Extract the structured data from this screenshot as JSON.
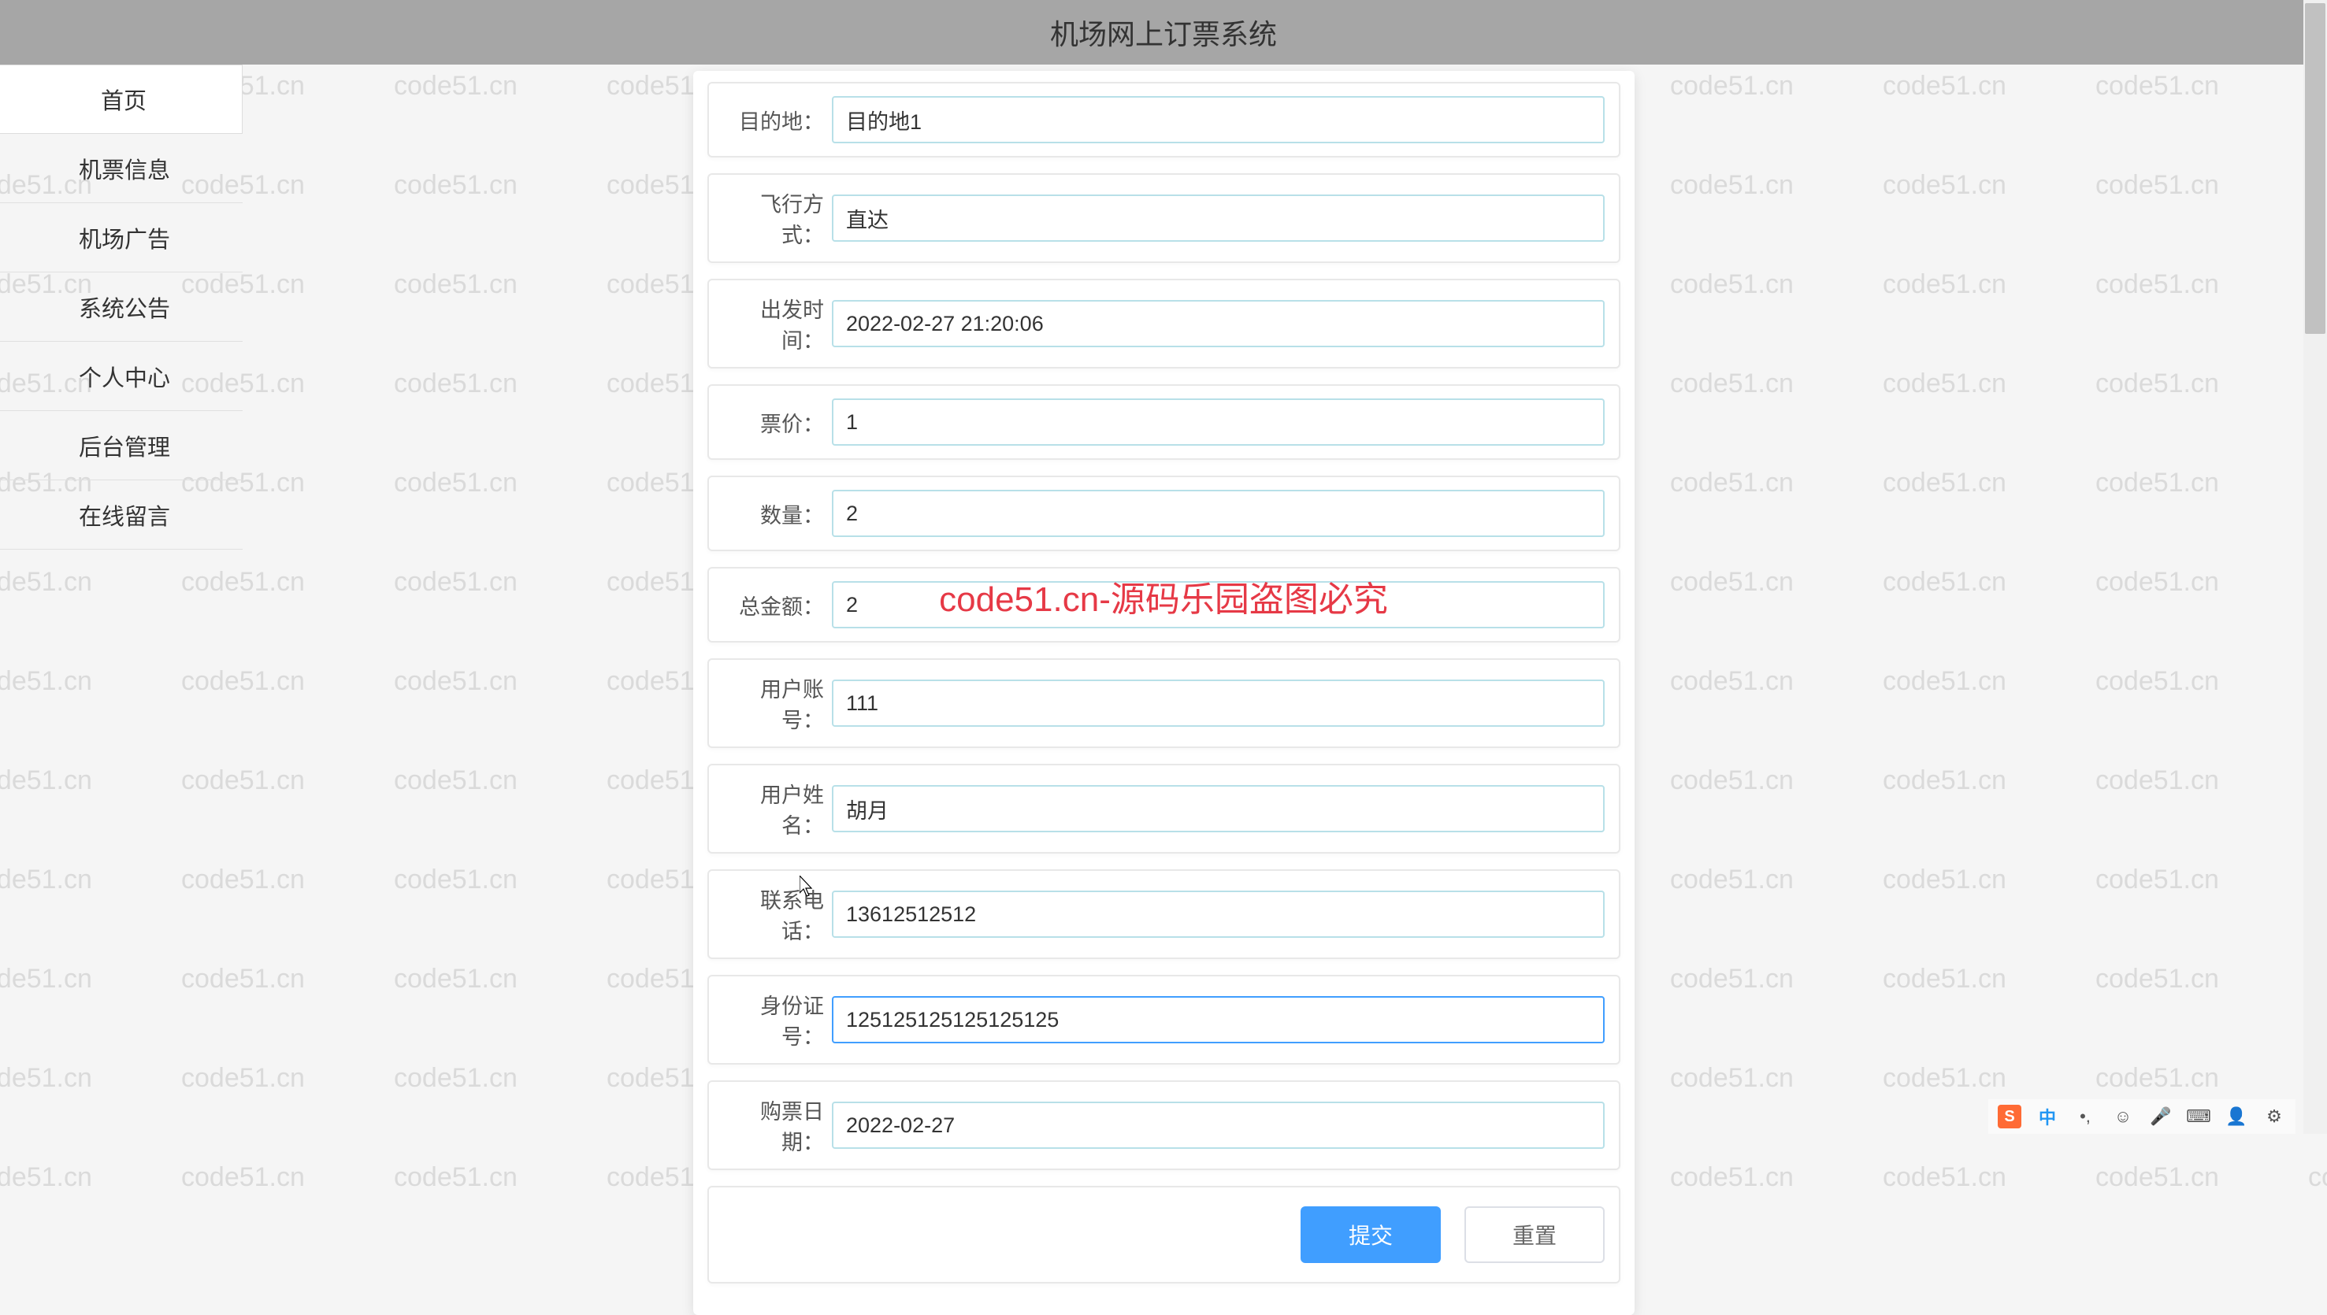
{
  "header": {
    "title": "机场网上订票系统"
  },
  "sidebar": {
    "items": [
      {
        "label": "首页",
        "active": true
      },
      {
        "label": "机票信息",
        "active": false
      },
      {
        "label": "机场广告",
        "active": false
      },
      {
        "label": "系统公告",
        "active": false
      },
      {
        "label": "个人中心",
        "active": false
      },
      {
        "label": "后台管理",
        "active": false
      },
      {
        "label": "在线留言",
        "active": false
      }
    ]
  },
  "form": {
    "fields": [
      {
        "label": "目的地：",
        "value": "目的地1",
        "name": "destination"
      },
      {
        "label": "飞行方式：",
        "value": "直达",
        "name": "flight-mode"
      },
      {
        "label": "出发时间：",
        "value": "2022-02-27 21:20:06",
        "name": "depart-time"
      },
      {
        "label": "票价：",
        "value": "1",
        "name": "price"
      },
      {
        "label": "数量：",
        "value": "2",
        "name": "quantity"
      },
      {
        "label": "总金额：",
        "value": "2",
        "name": "total"
      },
      {
        "label": "用户账号：",
        "value": "111",
        "name": "account"
      },
      {
        "label": "用户姓名：",
        "value": "胡月",
        "name": "username"
      },
      {
        "label": "联系电话：",
        "value": "13612512512",
        "name": "phone"
      },
      {
        "label": "身份证号：",
        "value": "125125125125125125",
        "name": "id-number",
        "focused": true
      },
      {
        "label": "购票日期：",
        "value": "2022-02-27",
        "name": "purchase-date"
      }
    ],
    "submit_label": "提交",
    "reset_label": "重置"
  },
  "watermark_text": "code51.cn",
  "center_watermark": "code51.cn-源码乐园盗图必究"
}
